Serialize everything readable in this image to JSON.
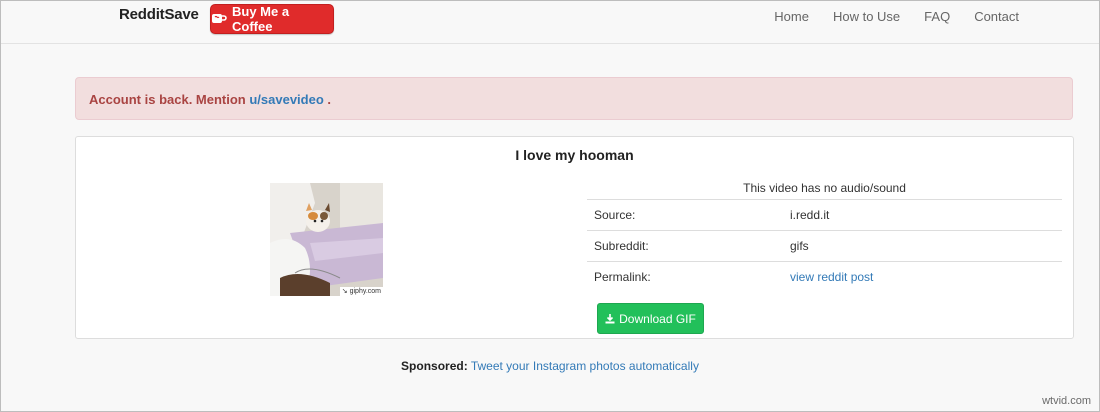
{
  "navbar": {
    "brand": "RedditSave",
    "coffee_button": "Buy Me a Coffee",
    "links": [
      "Home",
      "How to Use",
      "FAQ",
      "Contact"
    ]
  },
  "alert": {
    "text": "Account is back. Mention ",
    "link": "u/savevideo",
    "suffix": " ."
  },
  "post": {
    "title": "I love my hooman",
    "thumbnail_caption": "↘ giphy.com",
    "no_audio": "This video has no audio/sound",
    "rows": [
      {
        "key": "Source:",
        "value": "i.redd.it"
      },
      {
        "key": "Subreddit:",
        "value": "gifs"
      },
      {
        "key": "Permalink:",
        "value": "view reddit post"
      }
    ],
    "download_label": "Download GIF"
  },
  "sponsored": {
    "label": "Sponsored:",
    "link": "Tweet your Instagram photos automatically"
  },
  "watermark": "wtvid.com",
  "colors": {
    "coffee_button": "#e02b2b",
    "download_button": "#22c05a",
    "alert_bg": "#f2dede",
    "alert_text": "#a94442",
    "link": "#337ab7"
  }
}
